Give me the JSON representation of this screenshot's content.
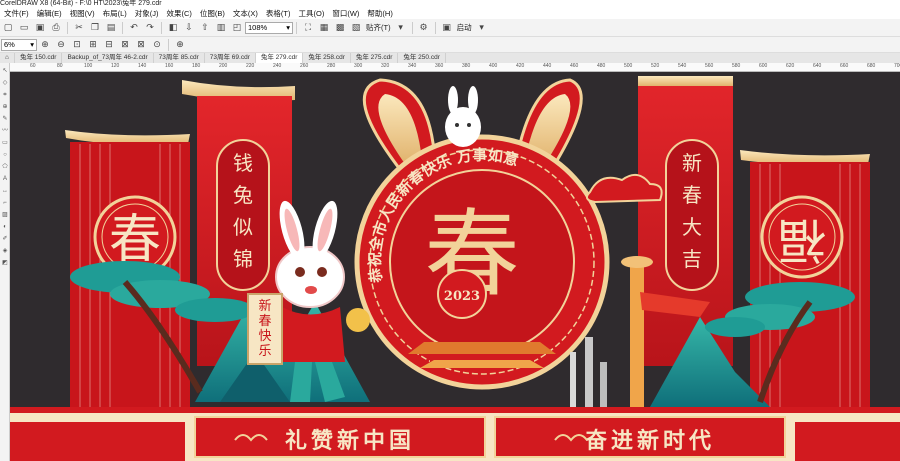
{
  "window": {
    "title": "CorelDRAW X8 (64-Bit) - F:\\0 HT\\2023\\兔年 279.cdr"
  },
  "menu": [
    "文件(F)",
    "编辑(E)",
    "视图(V)",
    "布局(L)",
    "对象(J)",
    "效果(C)",
    "位图(B)",
    "文本(X)",
    "表格(T)",
    "工具(O)",
    "窗口(W)",
    "帮助(H)"
  ],
  "toolbar": {
    "zoom": "108%",
    "snap_label": "贴齐(T)",
    "launch_label": "启动"
  },
  "toolbar2": {
    "zoom2": "6%"
  },
  "tabs": [
    "兔年 150.cdr",
    "Backup_of_73周年 46-2.cdr",
    "73周年 85.cdr",
    "73周年 69.cdr",
    "兔年 279.cdr",
    "兔年 258.cdr",
    "兔年 275.cdr",
    "兔年 250.cdr"
  ],
  "active_tab": 4,
  "ruler": [
    "60",
    "80",
    "100",
    "120",
    "140",
    "160",
    "180",
    "200",
    "220",
    "240",
    "260",
    "280",
    "300",
    "320",
    "340",
    "360",
    "380",
    "400",
    "420",
    "440",
    "460",
    "480",
    "500",
    "520",
    "540",
    "560",
    "580",
    "600",
    "620",
    "640",
    "660",
    "680",
    "700"
  ],
  "artwork": {
    "left_couplet": [
      "钱",
      "兔",
      "似",
      "锦"
    ],
    "right_couplet": [
      "新",
      "春",
      "大",
      "吉"
    ],
    "left_badge": "春",
    "right_badge": "福",
    "arc_text": "恭祝全市人民新春快乐 万事如意",
    "center_char": "春",
    "year": "2023",
    "scroll_text": [
      "新",
      "春",
      "快",
      "乐"
    ],
    "slogan_left": "礼赞新中国",
    "slogan_right": "奋进新时代",
    "colors": {
      "red": "#d21a1f",
      "deep_red": "#a50f14",
      "gold": "#f2d39a",
      "cream": "#f7e6c4",
      "teal": "#1f9c95",
      "dark_bg": "#2f2b2e"
    }
  }
}
